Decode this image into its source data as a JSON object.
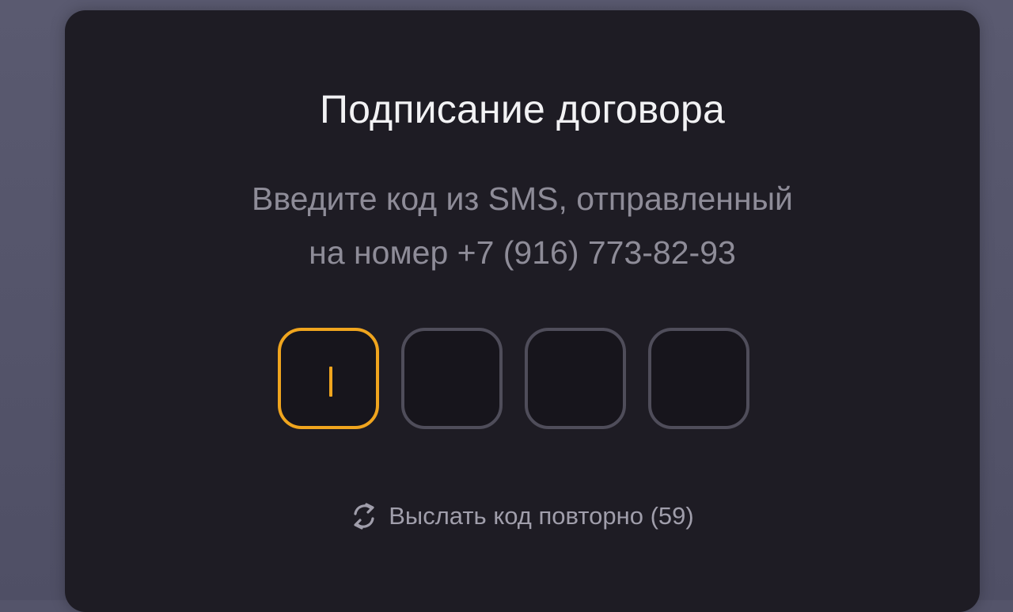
{
  "dialog": {
    "title": "Подписание договора",
    "subtitle_line1": "Введите код из  SMS, отправленный",
    "subtitle_line2": "на номер +7 (916) 773-82-93"
  },
  "code_input": {
    "digits": [
      "",
      "",
      "",
      ""
    ],
    "active_index": 0,
    "active_color": "#f0a51e"
  },
  "resend": {
    "icon": "refresh-icon",
    "label": "Выслать код повторно (59)"
  }
}
